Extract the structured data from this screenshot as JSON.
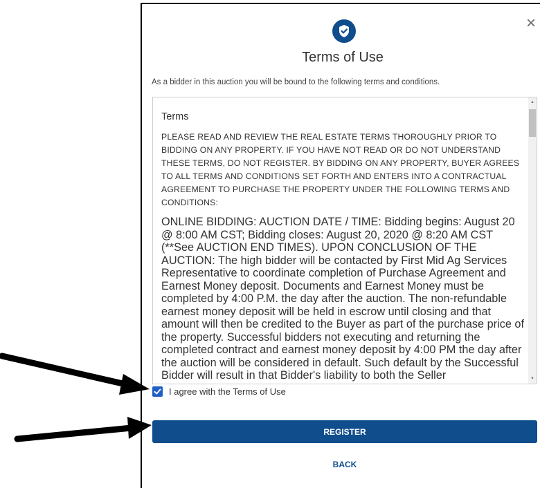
{
  "dialog": {
    "title": "Terms of Use",
    "intro": "As a bidder in this auction you will be bound to the following terms and conditions.",
    "close_icon": "close-icon",
    "header_icon": "shield-check-icon",
    "terms": {
      "heading": "Terms",
      "caps_paragraph": "PLEASE READ AND REVIEW THE REAL ESTATE TERMS THOROUGHLY PRIOR TO BIDDING ON ANY PROPERTY. IF YOU HAVE NOT READ OR DO NOT UNDERSTAND THESE TERMS, DO NOT REGISTER. BY BIDDING ON ANY PROPERTY, BUYER AGREES TO ALL TERMS AND CONDITIONS SET FORTH AND ENTERS INTO A CONTRACTUAL AGREEMENT TO PURCHASE THE PROPERTY UNDER THE FOLLOWING TERMS AND CONDITIONS:",
      "body_paragraph": "ONLINE BIDDING: AUCTION DATE / TIME: Bidding begins: August 20 @ 8:00 AM CST; Bidding closes: August 20, 2020 @ 8:20 AM CST (**See AUCTION END TIMES). UPON CONCLUSION OF THE AUCTION: The high bidder will be contacted by First Mid Ag Services Representative to coordinate completion of Purchase Agreement and Earnest Money deposit. Documents and Earnest Money must be completed by 4:00 P.M. the day after the auction. The non-refundable earnest money deposit will be held in escrow until closing and that amount will then be credited to the Buyer as part of the purchase price of the property. Successful bidders not executing and returning the completed contract and earnest money deposit by 4:00 PM the day after the auction will be considered in default. Such default by the Successful Bidder will result in that Bidder's liability to both the Seller"
    },
    "agree_label": "I agree with the Terms of Use",
    "agree_checked": true,
    "register_label": "REGISTER",
    "back_label": "BACK"
  },
  "colors": {
    "primary": "#0f4d8c",
    "checkbox": "#1f5fc7"
  }
}
